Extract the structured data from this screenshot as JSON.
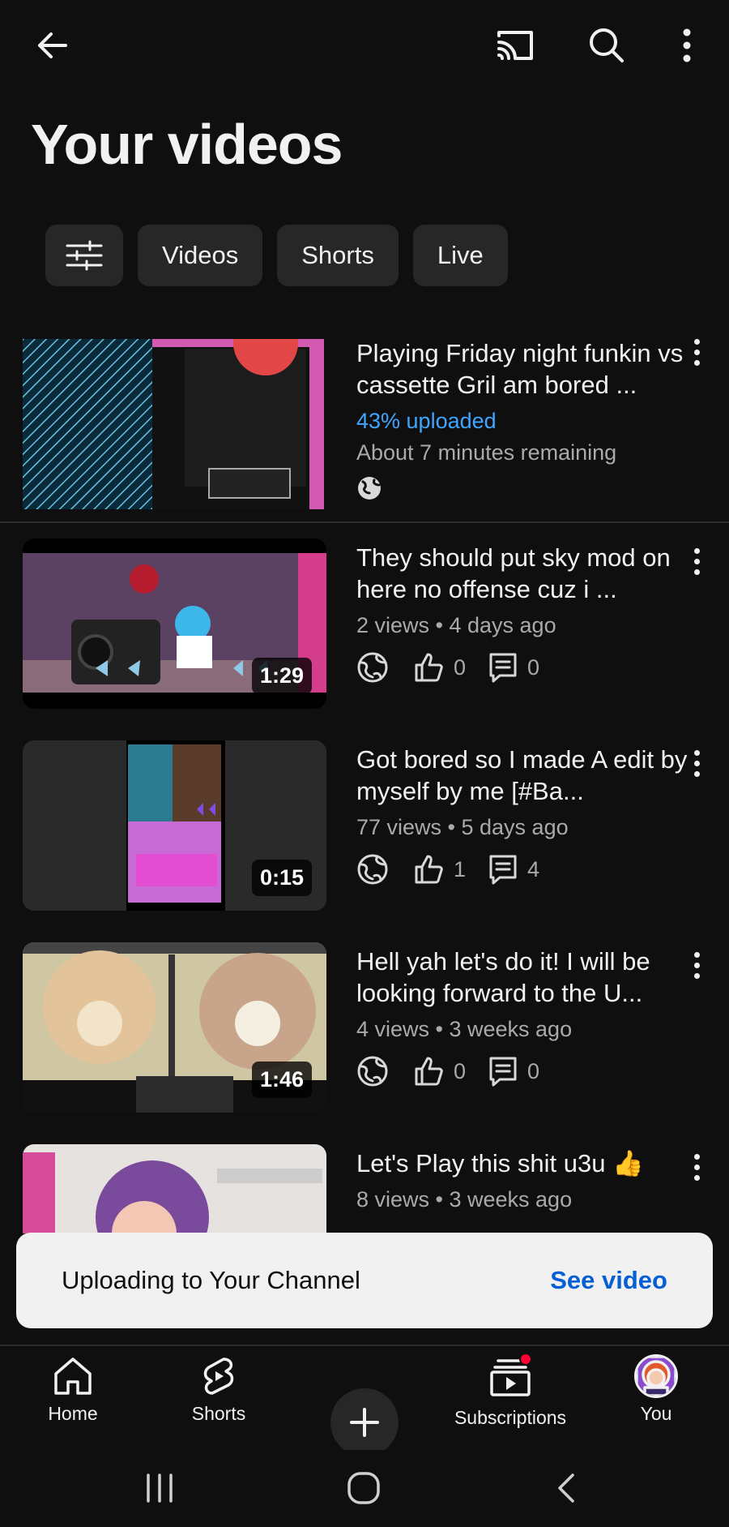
{
  "header": {
    "back_icon": "arrow-left-icon",
    "cast_icon": "cast-icon",
    "search_icon": "search-icon",
    "more_icon": "more-vert-icon",
    "title": "Your videos"
  },
  "filters": {
    "filter_icon": "tune-icon",
    "chips": [
      "Videos",
      "Shorts",
      "Live"
    ]
  },
  "videos": [
    {
      "title": "Playing  Friday night funkin vs cassette  Gril am bored ...",
      "progress": "43% uploaded",
      "remaining": "About 7 minutes remaining",
      "visibility_icon": "globe-icon"
    },
    {
      "title": "They should  put sky mod on here no offense  cuz i ...",
      "duration": "1:29",
      "meta": "2 views • 4 days ago",
      "likes": "0",
      "comments": "0"
    },
    {
      "title": "Got bored so I made A edit by myself by me [#Ba...",
      "duration": "0:15",
      "meta": "77 views • 5 days ago",
      "likes": "1",
      "comments": "4"
    },
    {
      "title": "Hell yah let's do it! I will be looking  forward to  the U...",
      "duration": "1:46",
      "meta": "4 views • 3 weeks ago",
      "likes": "0",
      "comments": "0"
    },
    {
      "title": "Let's Play this shit u3u 👍",
      "meta": "8 views • 3 weeks ago"
    }
  ],
  "toast": {
    "message": "Uploading to Your Channel",
    "action": "See video"
  },
  "bottom_nav": {
    "home": "Home",
    "shorts": "Shorts",
    "subscriptions": "Subscriptions",
    "you": "You"
  },
  "colors": {
    "background": "#0f0f0f",
    "progress_text": "#3ea6ff",
    "toast_action": "#065fd4",
    "notification_dot": "#ff0033"
  }
}
